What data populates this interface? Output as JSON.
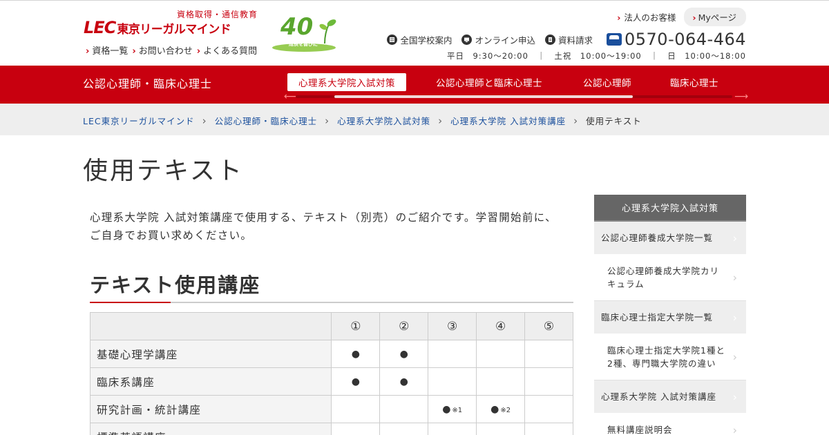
{
  "header": {
    "logo_tagline": "資格取得・通信教育",
    "logo_mark": "LEC",
    "logo_name": "東京リーガルマインド",
    "badge_number": "40",
    "badge_subtext": "成長を喜びに",
    "top_links": [
      "資格一覧",
      "お問い合わせ",
      "よくある質問"
    ],
    "corp_link": "法人のお客様",
    "mypage_link": "Myページ",
    "school_link": "全国学校案内",
    "online_link": "オンライン申込",
    "docs_link": "資料請求",
    "phone": "0570-064-464",
    "hours": "平日　9:30～20:00　｜　土祝　10:00～19:00　｜　日　10:00～18:00"
  },
  "nav": {
    "title": "公認心理師・臨床心理士",
    "tabs": [
      "心理系大学院入試対策",
      "公認心理師と臨床心理士",
      "公認心理師",
      "臨床心理士"
    ]
  },
  "breadcrumb": {
    "items": [
      "LEC東京リーガルマインド",
      "公認心理師・臨床心理士",
      "心理系大学院入試対策",
      "心理系大学院 入試対策講座"
    ],
    "current": "使用テキスト"
  },
  "page": {
    "title": "使用テキスト",
    "intro": "心理系大学院 入試対策講座で使用する、テキスト（別売）のご紹介です。学習開始前に、ご自身でお買い求めください。",
    "section_title": "テキスト使用講座"
  },
  "table": {
    "headers": [
      "",
      "①",
      "②",
      "③",
      "④",
      "⑤"
    ],
    "rows": [
      {
        "name": "基礎心理学講座",
        "cells": [
          "●",
          "●",
          "",
          "",
          ""
        ],
        "notes": [
          "",
          "",
          "",
          "",
          ""
        ]
      },
      {
        "name": "臨床系講座",
        "cells": [
          "●",
          "●",
          "",
          "",
          ""
        ],
        "notes": [
          "",
          "",
          "",
          "",
          ""
        ]
      },
      {
        "name": "研究計画・統計講座",
        "cells": [
          "",
          "",
          "●",
          "●",
          ""
        ],
        "notes": [
          "",
          "",
          "※1",
          "※2",
          ""
        ]
      },
      {
        "name": "標準英語講座",
        "cells": [
          "",
          "",
          "",
          "",
          ""
        ],
        "notes": [
          "",
          "",
          "",
          "",
          ""
        ]
      }
    ]
  },
  "sidebar": {
    "heading": "心理系大学院入試対策",
    "items": [
      {
        "label": "公認心理師養成大学院一覧",
        "sub": false
      },
      {
        "label": "公認心理師養成大学院カリキュラム",
        "sub": true
      },
      {
        "label": "臨床心理士指定大学院一覧",
        "sub": false
      },
      {
        "label": "臨床心理士指定大学院1種と2種、専門職大学院の違い",
        "sub": true
      },
      {
        "label": "心理系大学院 入試対策講座",
        "sub": false
      },
      {
        "label": "無料講座説明会",
        "sub": true
      }
    ]
  },
  "colors": {
    "brand_red": "#c8000f",
    "link_blue": "#1a4f9c",
    "sidebar_head": "#666666"
  }
}
